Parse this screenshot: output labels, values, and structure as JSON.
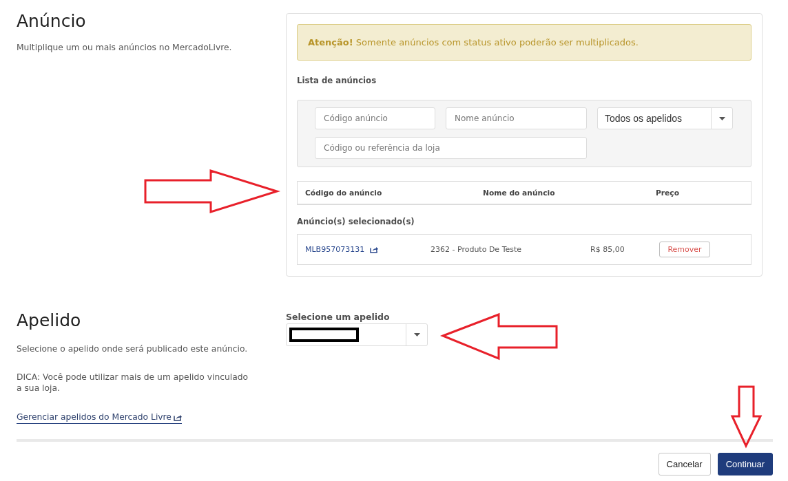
{
  "listing_section": {
    "title": "Anúncio",
    "description": "Multiplique um ou mais anúncios no MercadoLivre."
  },
  "alert": {
    "message": "**Atenção!** Somente anúncios com status ativo poderão ser multiplicados."
  },
  "listing_list": {
    "title": "Lista de anúncios",
    "filters": [
      {
        "kind": "input",
        "placeholder": "Código anúncio"
      },
      {
        "kind": "input",
        "placeholder": "Nome anúncio"
      },
      {
        "kind": "select",
        "value": "Todos os apelidos"
      },
      {
        "kind": "input",
        "placeholder": "Código ou referência da loja"
      }
    ],
    "table": {
      "columns": [
        "Código do anúncio",
        "Nome do anúncio",
        "Preço"
      ]
    }
  },
  "selected_listings": {
    "title": "Anúncio(s) selecionado(s)",
    "rows": [
      {
        "code": "MLB957073131",
        "name": "2362 - Produto De Teste",
        "price": "R$ 85,00",
        "action": "Remover"
      }
    ]
  },
  "nickname_section": {
    "title": "Apelido",
    "description": "Selecione o apelido onde será publicado este anúncio.",
    "tip": "DICA: Você pode utilizar mais de um apelido vinculado a sua loja.",
    "link": "Gerenciar apelidos do Mercado Livre",
    "select": {
      "label": "Selecione um apelido",
      "value_redacted": true
    }
  },
  "footer": {
    "buttons": [
      {
        "label": "Cancelar",
        "kind": "secondary"
      },
      {
        "label": "Continuar",
        "kind": "primary"
      }
    ]
  }
}
